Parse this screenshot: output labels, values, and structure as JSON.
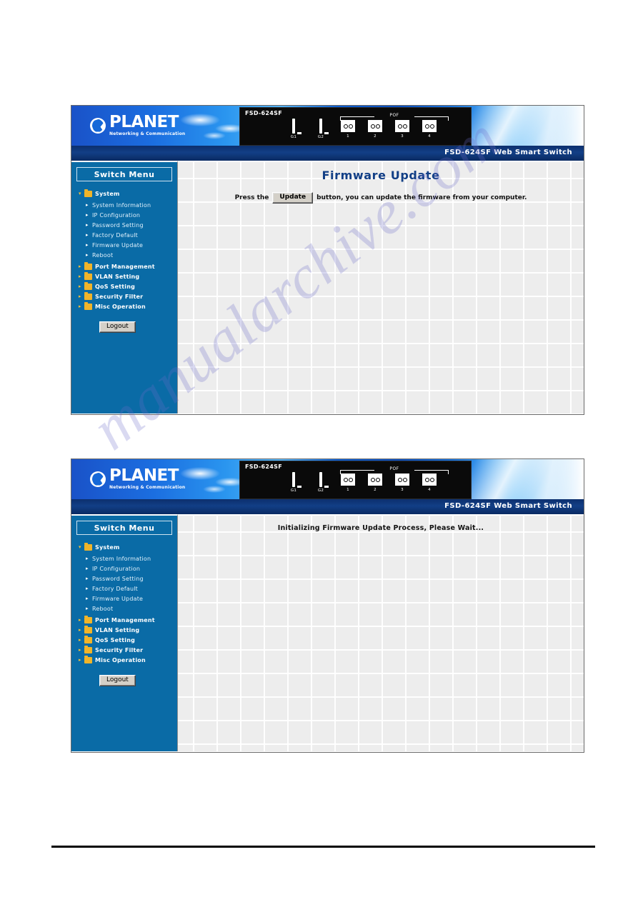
{
  "watermark": {
    "text": "manualarchive.com"
  },
  "device": {
    "model": "FSD-624SF",
    "pof_group_label": "POF",
    "ports": [
      {
        "id": "G1",
        "type": "rj45",
        "state": "active"
      },
      {
        "id": "G2",
        "type": "rj45",
        "state": "inactive"
      },
      {
        "id": "1",
        "type": "fiber",
        "state": "inactive"
      },
      {
        "id": "2",
        "type": "fiber",
        "state": "inactive"
      },
      {
        "id": "3",
        "type": "fiber",
        "state": "inactive"
      },
      {
        "id": "4",
        "type": "fiber",
        "state": "inactive"
      }
    ]
  },
  "logo": {
    "word": "PLANET",
    "tagline": "Networking & Communication"
  },
  "titlebar": {
    "text": "FSD-624SF Web Smart Switch"
  },
  "sidebar": {
    "heading": "Switch Menu",
    "system_group": {
      "label": "System",
      "icon": "folder-icon"
    },
    "system_items": [
      {
        "label": "System Information"
      },
      {
        "label": "IP Configuration"
      },
      {
        "label": "Password Setting"
      },
      {
        "label": "Factory Default"
      },
      {
        "label": "Firmware Update"
      },
      {
        "label": "Reboot"
      }
    ],
    "groups": [
      {
        "label": "Port Management"
      },
      {
        "label": "VLAN Setting"
      },
      {
        "label": "QoS Setting"
      },
      {
        "label": "Security Filter"
      },
      {
        "label": "Misc Operation"
      }
    ],
    "logout_label": "Logout"
  },
  "screen_one": {
    "title": "Firmware Update",
    "instruction_before": "Press the",
    "update_button_label": "Update",
    "instruction_after": "button, you can update the firmware from your computer."
  },
  "screen_two": {
    "status": "Initializing Firmware Update Process, Please Wait..."
  },
  "colors": {
    "sidebar_blue": "#0a6ba6",
    "titlebar_blue": "#123f86",
    "heading_blue": "#123f86",
    "folder_yellow": "#f0b429",
    "port_active_green": "#11e000",
    "content_gray": "#ededed"
  }
}
